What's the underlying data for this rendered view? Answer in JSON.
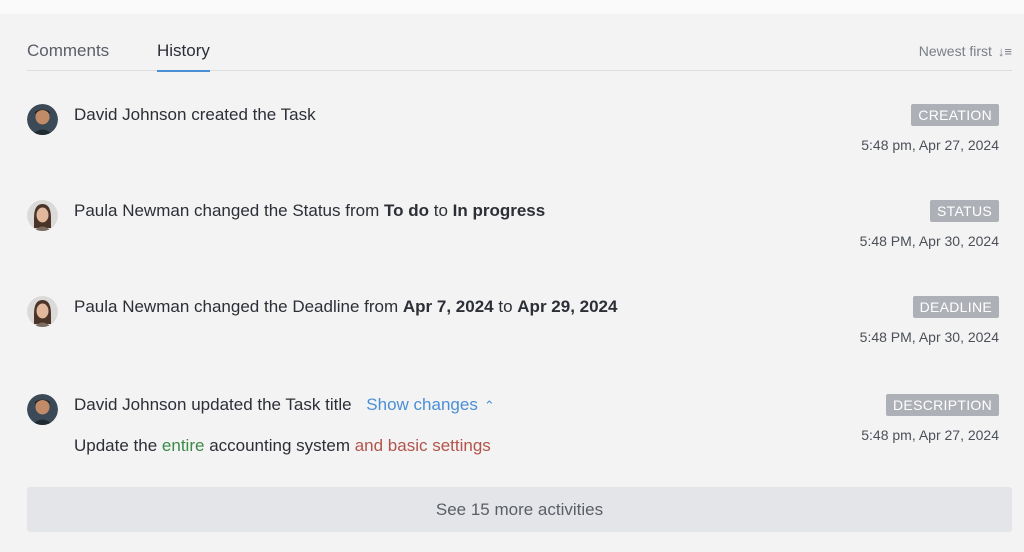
{
  "tabs": {
    "comments": "Comments",
    "history": "History"
  },
  "sort": {
    "label": "Newest first",
    "icon": "sort-descending-icon"
  },
  "activities": [
    {
      "user": "David Johnson",
      "action": "created the Task",
      "badge": "CREATION",
      "time": "5:48 pm, Apr 27, 2024"
    },
    {
      "user": "Paula Newman",
      "action_pre": "changed the Status from",
      "from": "To do",
      "mid": "to",
      "to": "In progress",
      "badge": "STATUS",
      "time": "5:48 PM, Apr 30, 2024"
    },
    {
      "user": "Paula Newman",
      "action_pre": "changed the Deadline from",
      "from": "Apr 7, 2024",
      "mid": "to",
      "to": "Apr 29, 2024",
      "badge": "DEADLINE",
      "time": "5:48 PM, Apr 30, 2024"
    },
    {
      "user": "David Johnson",
      "action": "updated the Task title",
      "show_changes": "Show changes",
      "diff": {
        "part1": "Update the",
        "added": "entire",
        "part2": "accounting system",
        "removed": "and basic settings"
      },
      "badge": "DESCRIPTION",
      "time": "5:48 pm, Apr 27, 2024"
    }
  ],
  "more_button": "See 15 more activities",
  "colors": {
    "accent": "#4a8fd6",
    "added": "#3b8a47",
    "removed": "#b2544c",
    "badge": "#aeb0b7"
  }
}
